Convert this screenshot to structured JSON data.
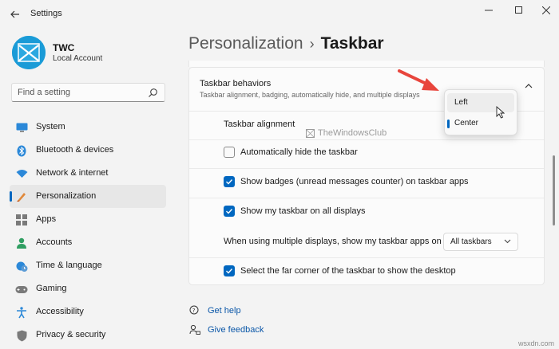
{
  "window": {
    "title": "Settings",
    "controls": [
      "minimize",
      "maximize",
      "close"
    ]
  },
  "user": {
    "name": "TWC",
    "account_type": "Local Account"
  },
  "search": {
    "placeholder": "Find a setting"
  },
  "sidebar": {
    "items": [
      {
        "label": "System",
        "icon": "monitor-icon",
        "active": false
      },
      {
        "label": "Bluetooth & devices",
        "icon": "bluetooth-icon",
        "active": false
      },
      {
        "label": "Network & internet",
        "icon": "wifi-icon",
        "active": false
      },
      {
        "label": "Personalization",
        "icon": "brush-icon",
        "active": true
      },
      {
        "label": "Apps",
        "icon": "apps-icon",
        "active": false
      },
      {
        "label": "Accounts",
        "icon": "person-icon",
        "active": false
      },
      {
        "label": "Time & language",
        "icon": "clock-globe-icon",
        "active": false
      },
      {
        "label": "Gaming",
        "icon": "gamepad-icon",
        "active": false
      },
      {
        "label": "Accessibility",
        "icon": "accessibility-icon",
        "active": false
      },
      {
        "label": "Privacy & security",
        "icon": "shield-icon",
        "active": false
      }
    ]
  },
  "breadcrumb": {
    "parent": "Personalization",
    "separator": "›",
    "current": "Taskbar"
  },
  "group": {
    "title": "Taskbar behaviors",
    "description": "Taskbar alignment, badging, automatically hide, and multiple displays",
    "expanded": true
  },
  "settings": {
    "alignment_label": "Taskbar alignment",
    "auto_hide": {
      "label": "Automatically hide the taskbar",
      "checked": false
    },
    "badges": {
      "label": "Show badges (unread messages counter) on taskbar apps",
      "checked": true
    },
    "all_displays": {
      "label": "Show my taskbar on all displays",
      "checked": true
    },
    "multi_display": {
      "label": "When using multiple displays, show my taskbar apps on",
      "value": "All taskbars"
    },
    "far_corner": {
      "label": "Select the far corner of the taskbar to show the desktop",
      "checked": true
    }
  },
  "alignment_popup": {
    "options": [
      "Left",
      "Center"
    ],
    "selected": "Center",
    "hovered": "Left"
  },
  "watermark": "TheWindowsClub",
  "links": {
    "help": "Get help",
    "feedback": "Give feedback"
  },
  "colors": {
    "accent": "#0067c0",
    "background": "#f3f3f3",
    "card": "#fbfbfb",
    "annotation_arrow": "#e8453c"
  },
  "corner_watermark": "wsxdn.com"
}
